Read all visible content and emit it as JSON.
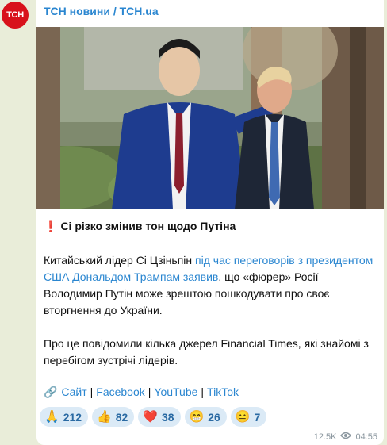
{
  "channel": {
    "avatar_text": "ТСН",
    "name": "ТСН новини / TCH.ua",
    "brand_color": "#d8121b"
  },
  "post": {
    "headline_icon": "❗",
    "headline": "Сі різко змінив тон щодо Путіна",
    "para1": {
      "pre": "Китайський лідер Сі Цзіньпін ",
      "link": "під час переговорів з президентом США Дональдом Трампам заявив",
      "post": ", що «фюрер» Росії Володимир Путін може зрештою пошкодувати про своє вторгнення до України."
    },
    "para2": "Про це повідомили кілька джерел Financial Times, які знайомі з перебігом зустрічі лідерів.",
    "links_icon": "🔗",
    "links": [
      {
        "label": "Сайт"
      },
      {
        "label": "Facebook"
      },
      {
        "label": "YouTube"
      },
      {
        "label": "TikTok"
      }
    ],
    "link_separator": "|"
  },
  "reactions": [
    {
      "emoji": "🙏",
      "count": "212",
      "icon": "pray-icon"
    },
    {
      "emoji": "👍",
      "count": "82",
      "icon": "thumbs-up-icon"
    },
    {
      "emoji": "❤️",
      "count": "38",
      "icon": "heart-icon"
    },
    {
      "emoji": "😁",
      "count": "26",
      "icon": "grin-icon"
    },
    {
      "emoji": "😐",
      "count": "7",
      "icon": "neutral-face-icon"
    }
  ],
  "meta": {
    "views": "12.5K",
    "time": "04:55"
  },
  "colors": {
    "link": "#2a86d0",
    "reaction_bg": "#dbeaf6",
    "chat_bg": "#e9edd9"
  }
}
